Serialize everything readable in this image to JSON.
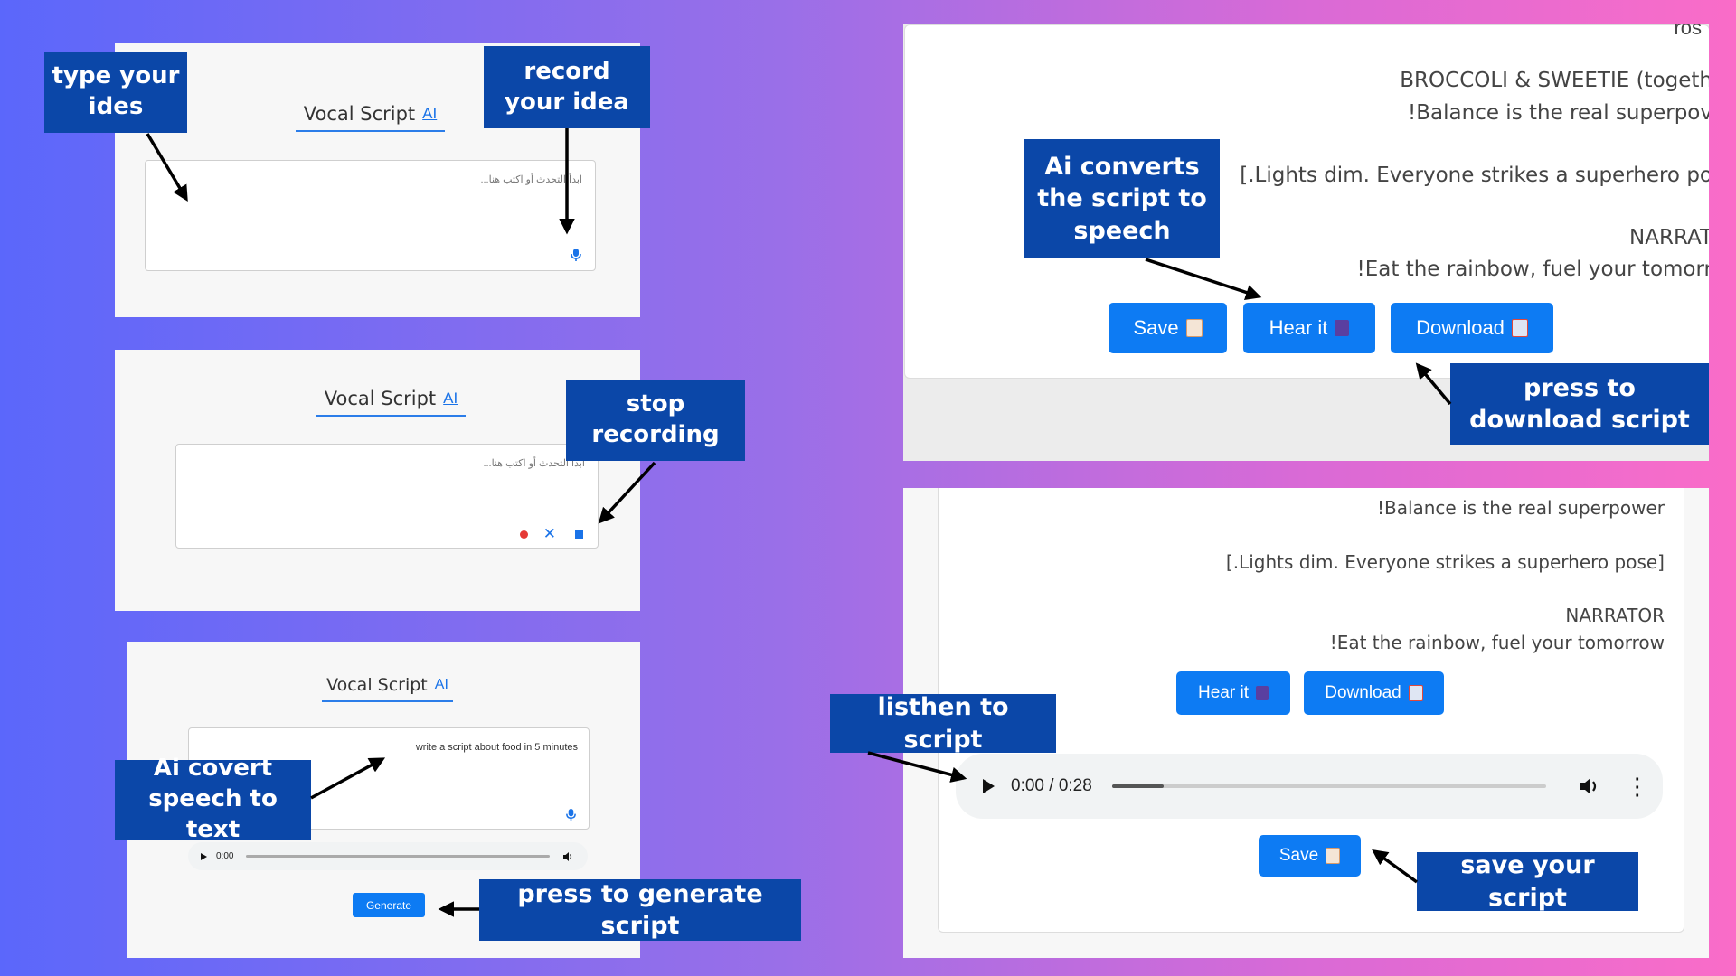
{
  "app": {
    "title": "Vocal Script",
    "ai_tag": "AI",
    "placeholder": "ابدأ التحدث أو اكتب هنا...",
    "transcribed_text": "write a script about food in 5 minutes",
    "generate_label": "Generate"
  },
  "callouts": {
    "type_idea": "type your ides",
    "record_idea": "record your idea",
    "stop_recording": "stop recording",
    "ai_speech_to_text": "Ai covert speech to text",
    "press_generate": "press to generate script",
    "ai_to_speech": "Ai converts the script to speech",
    "press_download": "press to download script",
    "listen_script": "listhen to script",
    "save_script": "save your script"
  },
  "mini_audio": {
    "time": "0:00"
  },
  "script_top": {
    "lines": [
      "BROCCOLI & SWEETIE (togeth",
      "!Balance is the real superpov",
      "[.Lights dim. Everyone strikes a superhero po",
      "NARRAT",
      "!Eat the rainbow, fuel your tomorr"
    ],
    "buttons": {
      "save": "Save",
      "hear": "Hear it",
      "download": "Download"
    }
  },
  "script_bottom": {
    "lines": [
      "!Balance is the real superpower",
      "[.Lights dim. Everyone strikes a superhero pose]",
      "NARRATOR",
      "!Eat the rainbow, fuel your tomorrow"
    ],
    "buttons": {
      "hear": "Hear it",
      "download": "Download",
      "save": "Save"
    },
    "audio": {
      "time": "0:00 / 0:28",
      "progress": 0.12
    }
  },
  "colors": {
    "accent": "#0d7bf3",
    "callout": "#0b47a8",
    "record_dot": "#e53935"
  }
}
